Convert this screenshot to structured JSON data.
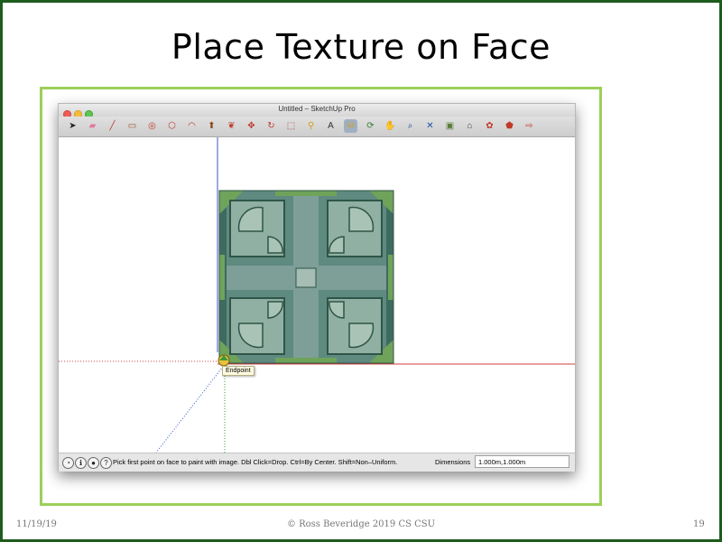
{
  "slide": {
    "title": "Place Texture on Face",
    "footer_date": "11/19/19",
    "footer_center": "© Ross Beveridge  2019 CS CSU",
    "page_number": "19",
    "border_color": "#1e5c1e",
    "frame_color": "#9ccf5a"
  },
  "window": {
    "title": "Untitled – SketchUp Pro"
  },
  "toolbar": {
    "tools": [
      {
        "name": "select-arrow-icon",
        "glyph": "➤",
        "color": "#222222"
      },
      {
        "name": "eraser-icon",
        "glyph": "▰",
        "color": "#e07a9a"
      },
      {
        "name": "pencil-line-icon",
        "glyph": "╱",
        "color": "#c0392b"
      },
      {
        "name": "rectangle-icon",
        "glyph": "▭",
        "color": "#a0522d"
      },
      {
        "name": "circle-icon",
        "glyph": "◎",
        "color": "#c0392b"
      },
      {
        "name": "polygon-icon",
        "glyph": "⬡",
        "color": "#c0392b"
      },
      {
        "name": "arc-icon",
        "glyph": "◠",
        "color": "#c0392b"
      },
      {
        "name": "push-pull-icon",
        "glyph": "⬆",
        "color": "#8b4513"
      },
      {
        "name": "follow-me-icon",
        "glyph": "❦",
        "color": "#c0392b"
      },
      {
        "name": "move-icon",
        "glyph": "✥",
        "color": "#c0392b"
      },
      {
        "name": "rotate-icon",
        "glyph": "↻",
        "color": "#c0392b"
      },
      {
        "name": "scale-icon",
        "glyph": "⬚",
        "color": "#b03030"
      },
      {
        "name": "tape-measure-icon",
        "glyph": "⚲",
        "color": "#d4a017"
      },
      {
        "name": "text-label-icon",
        "glyph": "A",
        "color": "#333333"
      },
      {
        "name": "paint-bucket-icon",
        "glyph": "⛁",
        "color": "#d4a017"
      },
      {
        "name": "orbit-icon",
        "glyph": "⟳",
        "color": "#2e7d32"
      },
      {
        "name": "pan-hand-icon",
        "glyph": "✋",
        "color": "#555555"
      },
      {
        "name": "zoom-icon",
        "glyph": "⌕",
        "color": "#1f4e9c"
      },
      {
        "name": "zoom-extents-icon",
        "glyph": "✕",
        "color": "#1f4e9c"
      },
      {
        "name": "components-icon",
        "glyph": "▣",
        "color": "#5a7d3a"
      },
      {
        "name": "warehouse-icon",
        "glyph": "⌂",
        "color": "#444444"
      },
      {
        "name": "extension-warehouse-icon",
        "glyph": "✿",
        "color": "#c0392b"
      },
      {
        "name": "share-model-icon",
        "glyph": "⬟",
        "color": "#c0392b"
      },
      {
        "name": "send-to-layout-icon",
        "glyph": "⇨",
        "color": "#c0392b"
      }
    ],
    "active_tool": "paint-bucket-icon"
  },
  "viewport": {
    "tooltip": "Endpoint",
    "texture_colors": {
      "base": "#5e8a80",
      "dark": "#2f5548",
      "light": "#a9c4b6",
      "accent": "#6fa35a",
      "plate": "#8fb0a2"
    },
    "axis_colors": {
      "red": "#d04040",
      "green": "#3a9a3a",
      "blue": "#3a55c8"
    }
  },
  "status": {
    "text": "Pick first point on face to paint with image. Dbl Click=Drop. Ctrl=By Center. Shift=Non–Uniform.",
    "dimensions_label": "Dimensions",
    "dimensions_value": "1.000m,1.000m"
  }
}
